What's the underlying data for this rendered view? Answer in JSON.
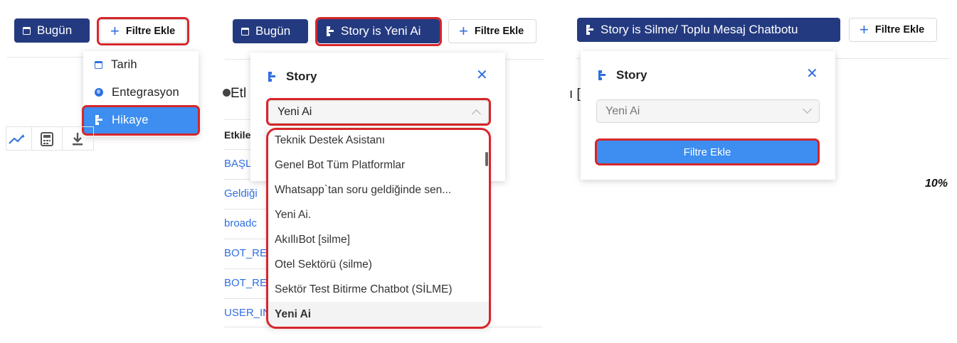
{
  "panel1": {
    "today_label": "Bugün",
    "add_filter_label": "Filtre Ekle",
    "menu": [
      {
        "label": "Tarih",
        "icon": "calendar-icon"
      },
      {
        "label": "Entegrasyon",
        "icon": "globe-icon"
      },
      {
        "label": "Hikaye",
        "icon": "story-tree-icon"
      }
    ],
    "toolbar_icons": [
      "chart-icon",
      "calculator-icon",
      "download-icon"
    ]
  },
  "panel2": {
    "today_label": "Bugün",
    "story_chip_label": "Story is Yeni Ai",
    "add_filter_label": "Filtre Ekle",
    "popup_title": "Story",
    "selected_value": "Yeni Ai",
    "options": [
      "Teknik Destek Asistanı",
      "Genel Bot Tüm Platformlar",
      "Whatsapp`tan soru geldiğinde sen...",
      "Yeni Ai.",
      "AkıllıBot [silme]",
      "Otel Sektörü (silme)",
      "Sektör Test Bitirme Chatbot (SİLME)",
      "Yeni Ai"
    ],
    "bg_heading_fragment": "Etl",
    "bg_table_header": "Etkile",
    "bg_links": [
      "BAŞL",
      "Geldiği",
      "broadc",
      "BOT_RE",
      "BOT_RE",
      "USER_IN"
    ]
  },
  "panel3": {
    "story_chip_label": "Story is Silme/ Toplu Mesaj Chatbotu",
    "add_filter_label": "Filtre Ekle",
    "popup_title": "Story",
    "selected_value": "Yeni Ai",
    "submit_label": "Filtre Ekle",
    "bg_fragment": "ı [",
    "bg_percent": "10%"
  },
  "colors": {
    "navy": "#243a80",
    "accent": "#3d8ef0",
    "highlight": "#d6262b"
  }
}
